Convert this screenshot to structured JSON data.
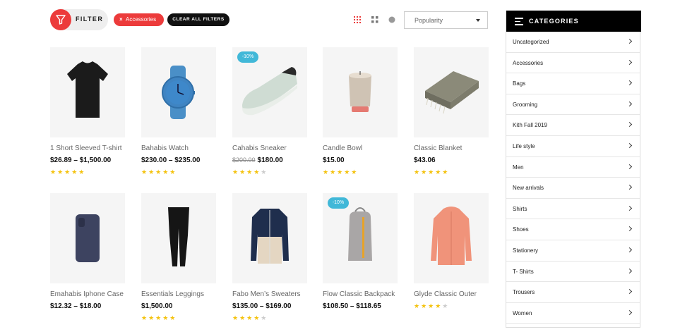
{
  "toolbar": {
    "filter_label": "FILTER",
    "active_filter": "Accessories",
    "active_filter_remove": "×",
    "clear_all": "CLEAR ALL FILTERS",
    "sort_value": "Popularity"
  },
  "products": [
    {
      "name": "1 Short Sleeved T-shirt",
      "price": "$26.89 – $1,500.00",
      "old_price": "",
      "badge": "",
      "rating": 5,
      "icon": "tshirt-image"
    },
    {
      "name": "Bahabis Watch",
      "price": "$230.00 – $235.00",
      "old_price": "",
      "badge": "",
      "rating": 5,
      "icon": "watch-image"
    },
    {
      "name": "Cahabis Sneaker",
      "price": "$180.00",
      "old_price": "$200.00",
      "badge": "-10%",
      "rating": 4,
      "icon": "sneaker-image"
    },
    {
      "name": "Candle Bowl",
      "price": "$15.00",
      "old_price": "",
      "badge": "",
      "rating": 5,
      "icon": "candle-image"
    },
    {
      "name": "Classic Blanket",
      "price": "$43.06",
      "old_price": "",
      "badge": "",
      "rating": 5,
      "icon": "blanket-image"
    },
    {
      "name": "Emahabis Iphone Case",
      "price": "$12.32 – $18.00",
      "old_price": "",
      "badge": "",
      "rating": 0,
      "icon": "phone-case-image"
    },
    {
      "name": "Essentials Leggings",
      "price": "$1,500.00",
      "old_price": "",
      "badge": "",
      "rating": 5,
      "icon": "leggings-image"
    },
    {
      "name": "Fabo Men’s Sweaters",
      "price": "$135.00 – $169.00",
      "old_price": "",
      "badge": "",
      "rating": 4,
      "icon": "sweater-image"
    },
    {
      "name": "Flow Classic Backpack",
      "price": "$108.50 – $118.65",
      "old_price": "",
      "badge": "-10%",
      "rating": 0,
      "icon": "backpack-image"
    },
    {
      "name": "Glyde Classic Outer",
      "price": "",
      "old_price": "",
      "badge": "",
      "rating": 4,
      "icon": "jacket-image"
    }
  ],
  "sidebar": {
    "title": "CATEGORIES",
    "items": [
      {
        "label": "Uncategorized"
      },
      {
        "label": "Accessories"
      },
      {
        "label": "Bags"
      },
      {
        "label": "Grooming"
      },
      {
        "label": "Kith Fall 2019"
      },
      {
        "label": "Life style"
      },
      {
        "label": "Men"
      },
      {
        "label": "New arrivals"
      },
      {
        "label": "Shirts"
      },
      {
        "label": "Shoes"
      },
      {
        "label": "Stationery"
      },
      {
        "label": "T- Shirts"
      },
      {
        "label": "Trousers"
      },
      {
        "label": "Women"
      }
    ]
  },
  "colors": {
    "accent": "#ec3b3b",
    "badge": "#41b8d8",
    "star": "#f4c20d"
  }
}
